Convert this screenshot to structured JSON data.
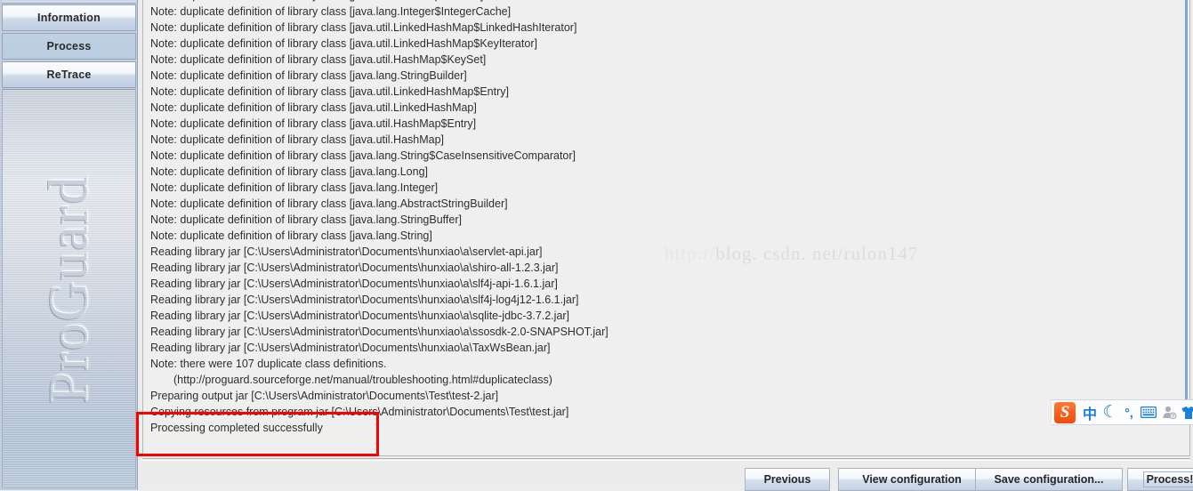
{
  "sidebar": {
    "nav": [
      {
        "label": "Information",
        "selected": false
      },
      {
        "label": "Process",
        "selected": true
      },
      {
        "label": "ReTrace",
        "selected": false
      }
    ],
    "brand": "ProGuard"
  },
  "log": {
    "lines": [
      {
        "text": "Note: duplicate definition of library class [java.util.HashMap$Values]",
        "indent": false
      },
      {
        "text": "Note: duplicate definition of library class [java.lang.Integer$IntegerCache]",
        "indent": false
      },
      {
        "text": "Note: duplicate definition of library class [java.util.LinkedHashMap$LinkedHashIterator]",
        "indent": false
      },
      {
        "text": "Note: duplicate definition of library class [java.util.LinkedHashMap$KeyIterator]",
        "indent": false
      },
      {
        "text": "Note: duplicate definition of library class [java.util.HashMap$KeySet]",
        "indent": false
      },
      {
        "text": "Note: duplicate definition of library class [java.lang.StringBuilder]",
        "indent": false
      },
      {
        "text": "Note: duplicate definition of library class [java.util.LinkedHashMap$Entry]",
        "indent": false
      },
      {
        "text": "Note: duplicate definition of library class [java.util.LinkedHashMap]",
        "indent": false
      },
      {
        "text": "Note: duplicate definition of library class [java.util.HashMap$Entry]",
        "indent": false
      },
      {
        "text": "Note: duplicate definition of library class [java.util.HashMap]",
        "indent": false
      },
      {
        "text": "Note: duplicate definition of library class [java.lang.String$CaseInsensitiveComparator]",
        "indent": false
      },
      {
        "text": "Note: duplicate definition of library class [java.lang.Long]",
        "indent": false
      },
      {
        "text": "Note: duplicate definition of library class [java.lang.Integer]",
        "indent": false
      },
      {
        "text": "Note: duplicate definition of library class [java.lang.AbstractStringBuilder]",
        "indent": false
      },
      {
        "text": "Note: duplicate definition of library class [java.lang.StringBuffer]",
        "indent": false
      },
      {
        "text": "Note: duplicate definition of library class [java.lang.String]",
        "indent": false
      },
      {
        "text": "Reading library jar [C:\\Users\\Administrator\\Documents\\hunxiao\\a\\servlet-api.jar]",
        "indent": false
      },
      {
        "text": "Reading library jar [C:\\Users\\Administrator\\Documents\\hunxiao\\a\\shiro-all-1.2.3.jar]",
        "indent": false
      },
      {
        "text": "Reading library jar [C:\\Users\\Administrator\\Documents\\hunxiao\\a\\slf4j-api-1.6.1.jar]",
        "indent": false
      },
      {
        "text": "Reading library jar [C:\\Users\\Administrator\\Documents\\hunxiao\\a\\slf4j-log4j12-1.6.1.jar]",
        "indent": false
      },
      {
        "text": "Reading library jar [C:\\Users\\Administrator\\Documents\\hunxiao\\a\\sqlite-jdbc-3.7.2.jar]",
        "indent": false
      },
      {
        "text": "Reading library jar [C:\\Users\\Administrator\\Documents\\hunxiao\\a\\ssosdk-2.0-SNAPSHOT.jar]",
        "indent": false
      },
      {
        "text": "Reading library jar [C:\\Users\\Administrator\\Documents\\hunxiao\\a\\TaxWsBean.jar]",
        "indent": false
      },
      {
        "text": "Note: there were 107 duplicate class definitions.",
        "indent": false
      },
      {
        "text": "(http://proguard.sourceforge.net/manual/troubleshooting.html#duplicateclass)",
        "indent": true
      },
      {
        "text": "Preparing output jar [C:\\Users\\Administrator\\Documents\\Test\\test-2.jar]",
        "indent": false
      },
      {
        "text": "Copying resources from program jar [C:\\Users\\Administrator\\Documents\\Test\\test.jar]",
        "indent": false
      },
      {
        "text": "Processing completed successfully",
        "indent": false
      }
    ],
    "watermark_faint": "http://",
    "watermark": "blog. csdn. net/rulon147",
    "highlight_color": "#fb0000"
  },
  "buttons": {
    "previous": "Previous",
    "view_configuration": "View configuration",
    "save_configuration": "Save configuration...",
    "process": "Process!"
  },
  "ime": {
    "logo": "S",
    "mode": "中",
    "moon": "☾",
    "punct": "°,",
    "keyboard": "keyboard-icon",
    "user": "user-icon",
    "skin": "skin-icon"
  }
}
